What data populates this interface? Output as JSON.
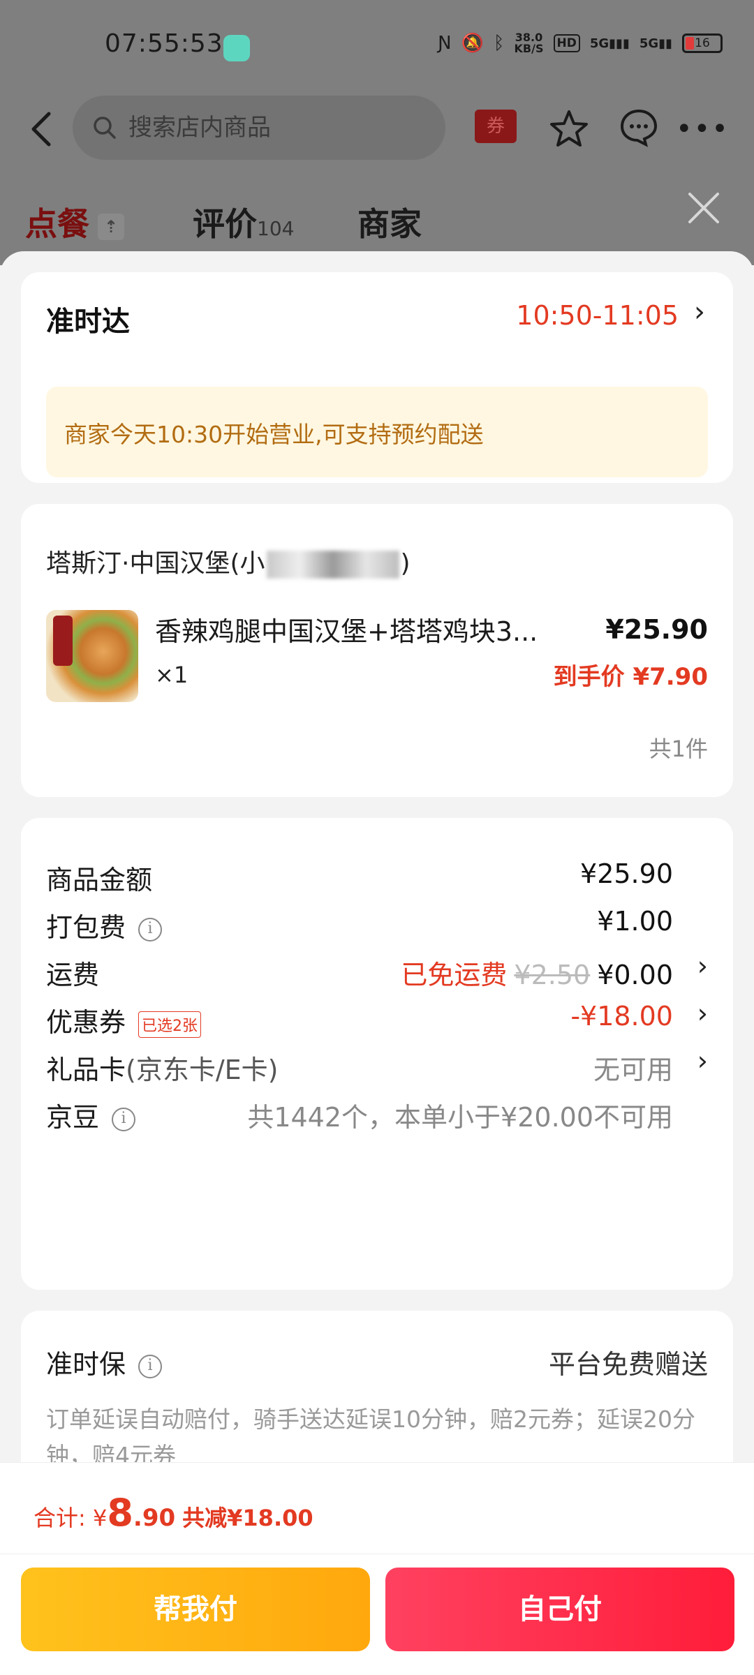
{
  "status_bar": {
    "time": "07:55:53",
    "net_speed_top": "38.0",
    "net_speed_unit": "KB/S",
    "hd": "HD",
    "sig1": "5G",
    "sig2": "5G",
    "battery": "16"
  },
  "search": {
    "placeholder": "搜索店内商品"
  },
  "header": {
    "coupon_label": "券"
  },
  "tabs": {
    "order": "点餐",
    "review": "评价",
    "review_count": "104",
    "store": "商家"
  },
  "delivery": {
    "title": "准时达",
    "time_range": "10:50-11:05",
    "notice": "商家今天10:30开始营业,可支持预约配送"
  },
  "store": {
    "name_prefix": "塔斯汀·中国汉堡(小",
    "name_suffix": ")",
    "product": {
      "name": "香辣鸡腿中国汉堡+塔塔鸡块3...",
      "qty": "×1",
      "price": "¥25.90",
      "final_label": "到手价",
      "final_price": "¥7.90"
    },
    "item_count": "共1件"
  },
  "fees": {
    "goods_label": "商品金额",
    "goods_value": "¥25.90",
    "pack_label": "打包费",
    "pack_value": "¥1.00",
    "ship_label": "运费",
    "ship_free": "已免运费",
    "ship_orig": "¥2.50",
    "ship_value": "¥0.00",
    "coupon_label": "优惠券",
    "coupon_tag": "已选2张",
    "coupon_value": "-¥18.00",
    "gift_label": "礼品卡",
    "gift_sub": "(京东卡/E卡)",
    "gift_value": "无可用",
    "jd_label": "京豆",
    "jd_value": "共1442个，本单小于¥20.00不可用"
  },
  "guarantee": {
    "title": "准时保",
    "free": "平台免费赠送",
    "desc": "订单延误自动赔付，骑手送达延误10分钟，赔2元券；延误20分钟，赔4元券"
  },
  "footer": {
    "total_label": "合计: ¥",
    "total_int": "8",
    "total_dec": ".90",
    "saved": "共减¥18.00",
    "help_pay": "帮我付",
    "self_pay": "自己付"
  },
  "colors": {
    "accent_red": "#e33a22",
    "pay_yellow": "#ffb515",
    "pay_red": "#ff2e4d",
    "notice_bg": "#fff7e1"
  }
}
